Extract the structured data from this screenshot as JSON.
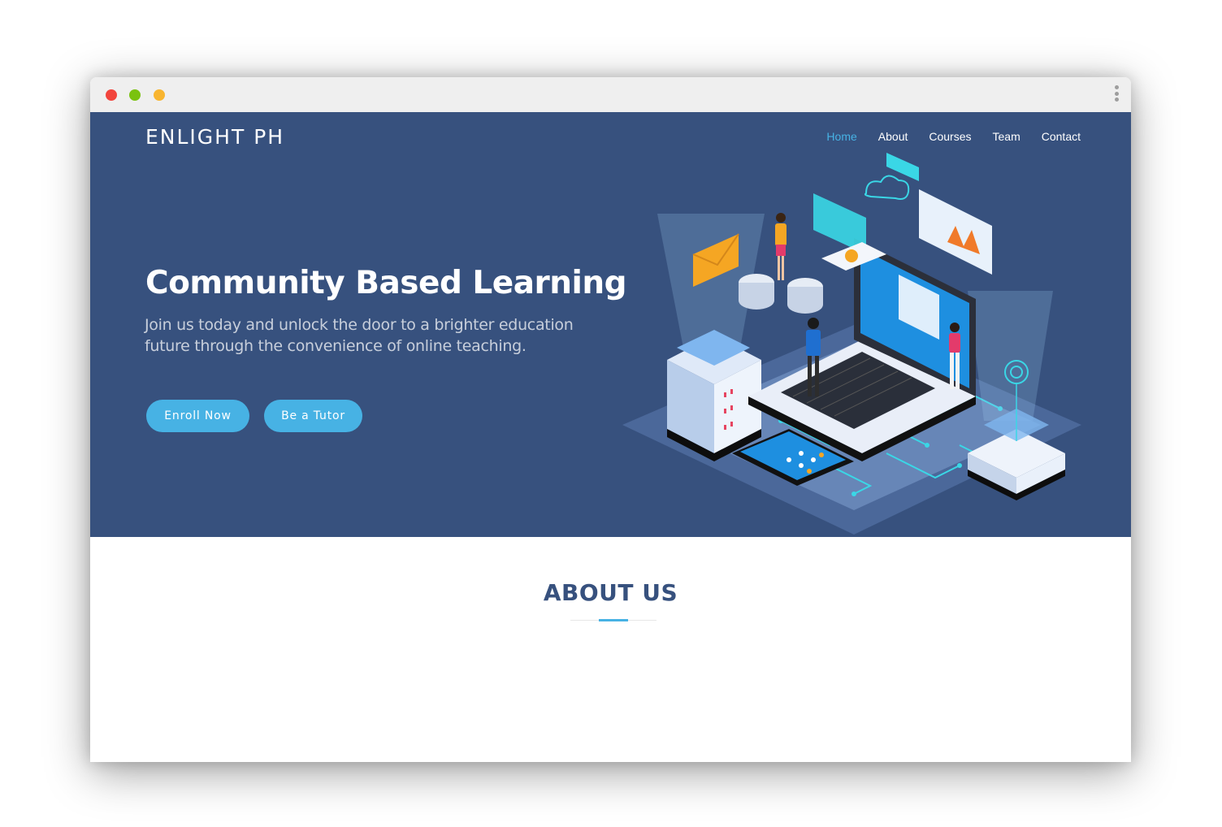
{
  "brand": {
    "logo": "ENLIGHT PH"
  },
  "nav": {
    "items": [
      "Home",
      "About",
      "Courses",
      "Team",
      "Contact"
    ],
    "active": "Home"
  },
  "hero": {
    "title": "Community Based Learning",
    "subtitle": "Join us today and unlock the door to a brighter education future through the convenience of online teaching.",
    "buttons": {
      "enroll": "Enroll Now",
      "tutor": "Be a Tutor"
    }
  },
  "about": {
    "title": "ABOUT US"
  },
  "colors": {
    "hero_bg": "#37517e",
    "accent": "#47b2e4",
    "heading": "#37517e",
    "titlebar": "#efefef"
  },
  "icons": [
    "close-dot",
    "minimize-dot",
    "maximize-dot",
    "more-vertical-icon",
    "isometric-learning-illustration"
  ]
}
